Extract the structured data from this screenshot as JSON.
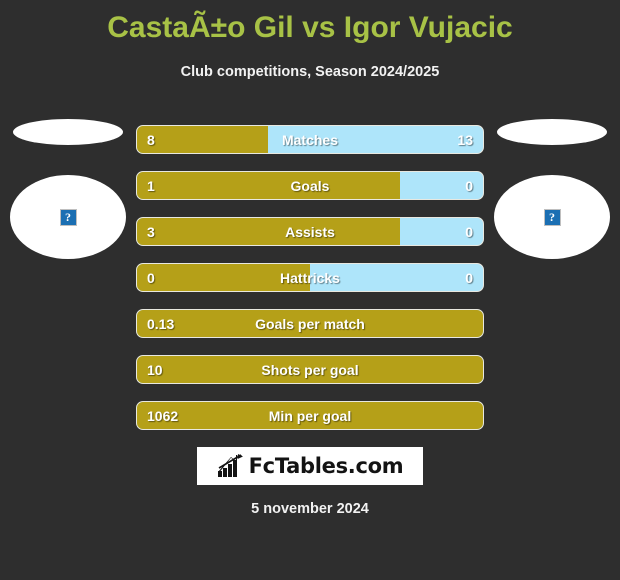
{
  "header": {
    "title": "CastaÃ±o Gil vs Igor Vujacic",
    "subtitle": "Club competitions, Season 2024/2025"
  },
  "players": {
    "left": {
      "avatar_icon": "broken-image-icon",
      "avatar_glyph": "?"
    },
    "right": {
      "avatar_icon": "broken-image-icon",
      "avatar_glyph": "?"
    }
  },
  "colors": {
    "background": "#2e2e2e",
    "title": "#a8c246",
    "home_bar": "#b5a018",
    "away_bar": "#aee5fa",
    "bar_border": "#e8e8e0",
    "text": "#ffffff"
  },
  "chart_data": {
    "type": "bar",
    "title": "CastaÃ±o Gil vs Igor Vujacic",
    "subtitle": "Club competitions, Season 2024/2025",
    "orientation": "horizontal-diverging",
    "series": [
      {
        "name": "CastaÃ±o Gil",
        "color": "#b5a018",
        "side": "left"
      },
      {
        "name": "Igor Vujacic",
        "color": "#aee5fa",
        "side": "right"
      }
    ],
    "categories": [
      "Matches",
      "Goals",
      "Assists",
      "Hattricks",
      "Goals per match",
      "Shots per goal",
      "Min per goal"
    ],
    "rows": [
      {
        "label": "Matches",
        "left_value": "8",
        "right_value": "13",
        "left_pct": 38,
        "two_sided": true
      },
      {
        "label": "Goals",
        "left_value": "1",
        "right_value": "0",
        "left_pct": 76,
        "two_sided": true
      },
      {
        "label": "Assists",
        "left_value": "3",
        "right_value": "0",
        "left_pct": 76,
        "two_sided": true
      },
      {
        "label": "Hattricks",
        "left_value": "0",
        "right_value": "0",
        "left_pct": 50,
        "two_sided": true
      },
      {
        "label": "Goals per match",
        "left_value": "0.13",
        "right_value": "",
        "left_pct": 100,
        "two_sided": false
      },
      {
        "label": "Shots per goal",
        "left_value": "10",
        "right_value": "",
        "left_pct": 100,
        "two_sided": false
      },
      {
        "label": "Min per goal",
        "left_value": "1062",
        "right_value": "",
        "left_pct": 100,
        "two_sided": false
      }
    ]
  },
  "logo": {
    "text": "FcTables.com",
    "icon": "bar-chart-growth-icon"
  },
  "footer": {
    "date": "5 november 2024"
  }
}
